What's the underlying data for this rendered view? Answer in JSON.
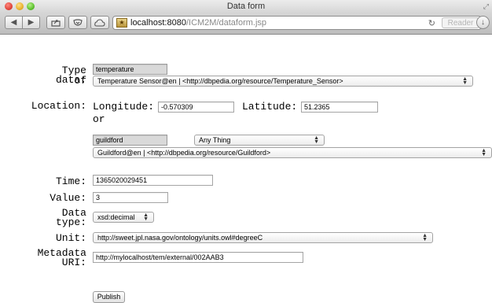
{
  "window": {
    "title": "Data form"
  },
  "toolbar": {
    "url_host": "localhost:8080",
    "url_path": "/ICM2M/dataform.jsp",
    "reader_label": "Reader"
  },
  "form": {
    "type_of_data": {
      "label_line1": "Type of",
      "label_line2": "data:",
      "value": "temperature",
      "selected_option": "Temperature Sensor@en | <http://dbpedia.org/resource/Temperature_Sensor>"
    },
    "location": {
      "label": "Location:",
      "longitude_label": "Longitude:",
      "longitude_value": "-0.570309",
      "latitude_label": "Latitude:",
      "latitude_value": "51.2365",
      "or_label": "or",
      "place_value": "guildford",
      "place_type_selected": "Any Thing",
      "place_selected_option": "Guildford@en | <http://dbpedia.org/resource/Guildford>"
    },
    "time": {
      "label": "Time:",
      "value": "1365020029451"
    },
    "value": {
      "label": "Value:",
      "value": "3"
    },
    "data_type": {
      "label_line1": "Data",
      "label_line2": "type:",
      "selected_option": "xsd:decimal"
    },
    "unit": {
      "label": "Unit:",
      "selected_option": "http://sweet.jpl.nasa.gov/ontology/units.owl#degreeC"
    },
    "metadata_uri": {
      "label_line1": "Metadata",
      "label_line2": "URI:",
      "value": "http://mylocalhost/tem/external/002AAB3"
    },
    "publish_label": "Publish"
  }
}
